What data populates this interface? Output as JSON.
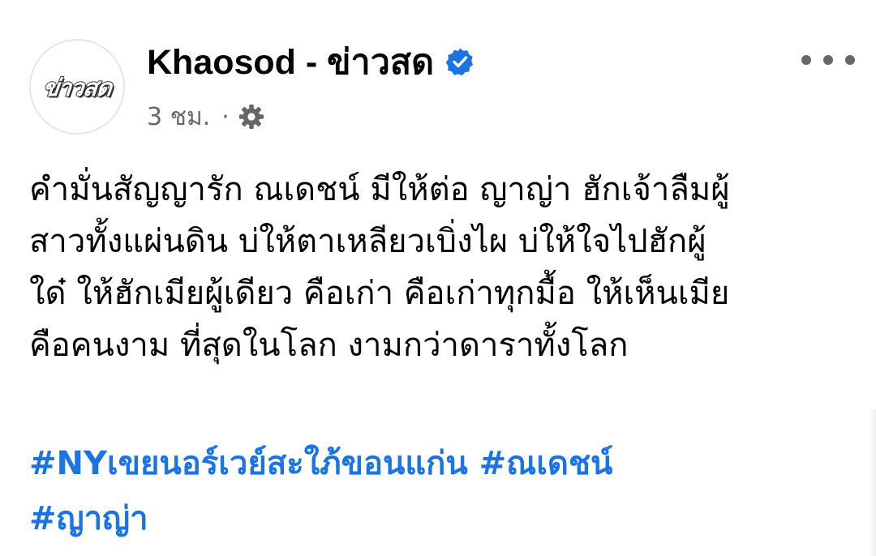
{
  "header": {
    "avatar_logo": "ข่าวสด",
    "page_name": "Khaosod - ข่าวสด",
    "verified_icon": "verified-badge-icon",
    "timestamp": "3 ชม.",
    "separator": "·",
    "audience_icon": "gear-icon",
    "more_icon": "more-dots-icon"
  },
  "post": {
    "lines": [
      "คำมั่นสัญญารัก ณเดชน์ มีให้ต่อ ญาญ่า ฮักเจ้าลืมผู้",
      "สาวทั้งแผ่นดิน บ่ให้ตาเหลียวเบิ่งไผ บ่ให้ใจไปฮักผู้",
      "ใด๋ ให้ฮักเมียผู้เดียว คือเก่า คือเก่าทุกมื้อ ให้เห็นเมีย",
      "คือคนงาม ที่สุดในโลก งามกว่าดาราทั้งโลก"
    ],
    "hashtags": [
      "#NYเขยนอร์เวย์สะใภ้ขอนแก่น",
      "#ณเดชน์",
      "#ญาญ่า"
    ]
  },
  "colors": {
    "link": "#1b74e4",
    "verified": "#1b74e4",
    "secondary_text": "#65676b",
    "primary_text": "#050505"
  }
}
